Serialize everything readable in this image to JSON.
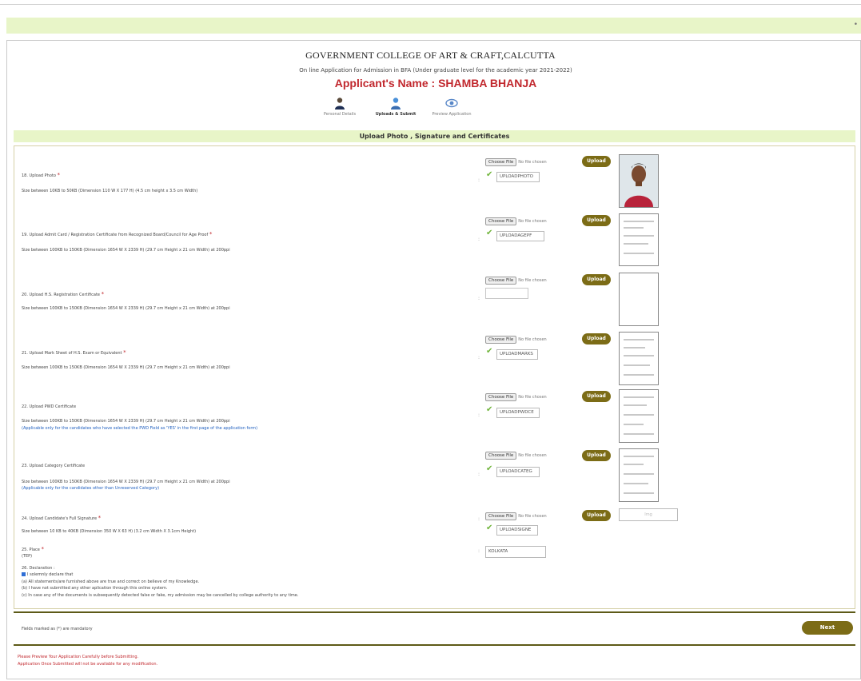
{
  "college_name": "GOVERNMENT COLLEGE OF ART & CRAFT,CALCUTTA",
  "subtitle": "On line Application for Admission in BFA (Under graduate level for the academic year 2021-2022)",
  "applicant_line": "Applicant's Name : SHAMBA BHANJA",
  "steps": [
    {
      "label": "Personal Details",
      "icon": "person-icon"
    },
    {
      "label": "Uploads & Submit",
      "icon": "upload-user-icon"
    },
    {
      "label": "Preview Application",
      "icon": "eye-icon"
    }
  ],
  "section_title": "Upload Photo , Signature and Certificates",
  "choose_label": "Choose File",
  "no_file_label": "No file chosen",
  "upload_label": "Upload",
  "uploads": [
    {
      "label": "18. Upload Photo",
      "size": "Size between 10KB to 50KB (Dimension 110 W X 177 H) (4.5 cm height x 3.5 cm Width)",
      "filename": "UPLOADPHOTO",
      "note": ""
    },
    {
      "label": "19. Upload Admit Card / Registration Certificate from Recognized Board/Council for Age Proof",
      "size": "Size between 100KB to 150KB (Dimension 1654 W X 2339 H) (29.7 cm Height x 21 cm Width) at 200ppi",
      "filename": "UPLOADAGEPF",
      "note": ""
    },
    {
      "label": "20. Upload H.S. Registration Certificate",
      "size": "Size between 100KB to 150KB (Dimension 1654 W X 2339 H) (29.7 cm Height x 21 cm Width) at 200ppi",
      "filename": "",
      "note": ""
    },
    {
      "label": "21. Upload Mark Sheet of H.S. Exam or Equivalent",
      "size": "Size between 100KB to 150KB (Dimension 1654 W X 2339 H) (29.7 cm Height x 21 cm Width) at 200ppi",
      "filename": "UPLOADMARKS",
      "note": ""
    },
    {
      "label": "22. Upload PWD Certificate",
      "size": "Size between 100KB to 150KB (Dimension 1654 W X 2339 H) (29.7 cm Height x 21 cm Width) at 200ppi",
      "filename": "UPLOADPWDCE",
      "note": "(Applicable only for the candidates who have selected the PWD Field as 'YES' in the first page of the application form)"
    },
    {
      "label": "23. Upload Category Certificate",
      "size": "Size between 100KB to 150KB (Dimension 1654 W X 2339 H) (29.7 cm Height x 21 cm Width) at 200ppi",
      "filename": "UPLOADCATEG",
      "note": "(Applicable only for the candidates other than Unreserved Category)"
    },
    {
      "label": "24. Upload Candidate's Full Signature",
      "size": "Size between 10 KB to 40KB (Dimension 350 W X 63 H) (3.2 cm Width X 3.1cm Height)",
      "filename": "UPLOADSIGNE",
      "note": ""
    }
  ],
  "place": {
    "label": "25. Place",
    "sub": "(TEP)",
    "value": "KOLKATA"
  },
  "declaration": {
    "title": "26. Declaration :",
    "checkbox_label": "I solemnly declare that",
    "lines": [
      "(a) All statements/are furnished above are true and correct on believe of my Knowledge.",
      "(b) I have not submitted any other aplication through this online system.",
      "(c) In case any of the documents is subsequently detected false or fake, my admission may be cancelled by college authority to any time."
    ]
  },
  "mandatory_text": "Fields marked as (*) are mandatory",
  "next_label": "Next",
  "warnings": [
    "Please Preview Your Application Carefully before Submitting.",
    "Application Once Submitted will not be available for any modification."
  ],
  "signature_placeholder": "Img",
  "colors": {
    "accent_green": "#e8f5c8",
    "button_olive": "#7c6c16",
    "name_red": "#c1272d"
  }
}
